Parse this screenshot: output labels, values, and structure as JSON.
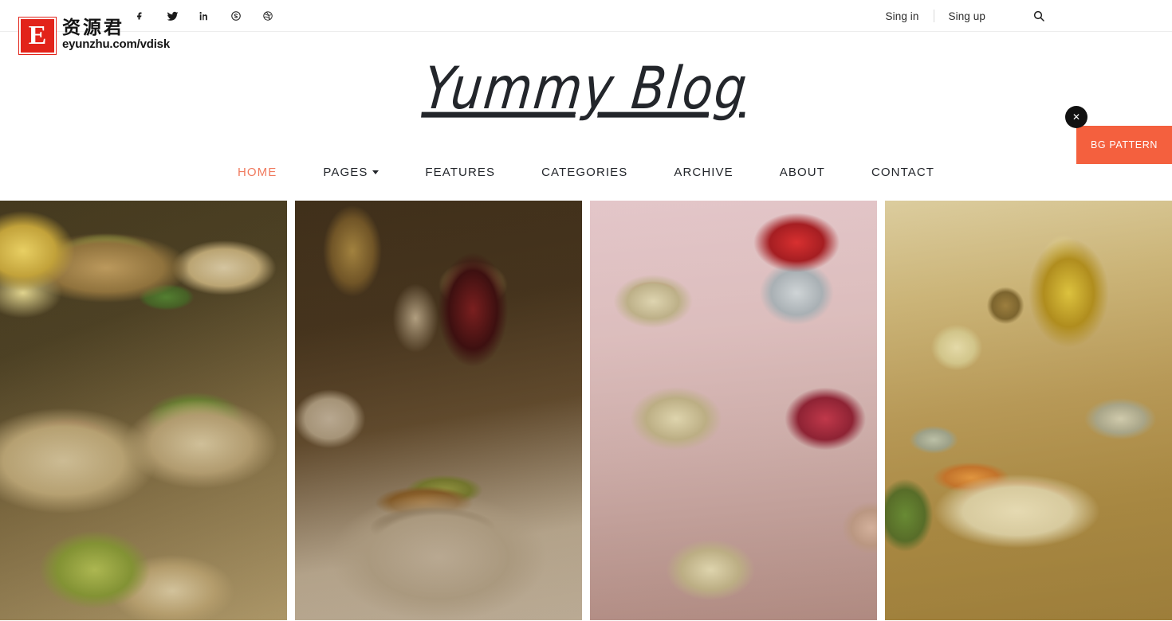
{
  "topbar": {
    "social": [
      {
        "name": "facebook-icon",
        "label": "Facebook"
      },
      {
        "name": "twitter-icon",
        "label": "Twitter"
      },
      {
        "name": "linkedin-icon",
        "label": "LinkedIn"
      },
      {
        "name": "skype-icon",
        "label": "Skype"
      },
      {
        "name": "dribbble-icon",
        "label": "Dribbble"
      }
    ],
    "sign_in": "Sing in",
    "sign_up": "Sing up",
    "search_icon": "search-icon"
  },
  "watermark": {
    "mark": "E",
    "cn": "资源君",
    "url": "eyunzhu.com/vdisk"
  },
  "brand": {
    "title": "Yummy Blog"
  },
  "bg_panel": {
    "label": "BG PATTERN",
    "close_label": "✕",
    "color": "#f4603e"
  },
  "nav": {
    "accent_color": "#f07a5e",
    "items": [
      {
        "label": "HOME",
        "active": true,
        "has_dropdown": false
      },
      {
        "label": "PAGES",
        "active": false,
        "has_dropdown": true
      },
      {
        "label": "FEATURES",
        "active": false,
        "has_dropdown": false
      },
      {
        "label": "CATEGORIES",
        "active": false,
        "has_dropdown": false
      },
      {
        "label": "ARCHIVE",
        "active": false,
        "has_dropdown": false
      },
      {
        "label": "ABOUT",
        "active": false,
        "has_dropdown": false
      },
      {
        "label": "CONTACT",
        "active": false,
        "has_dropdown": false
      }
    ]
  },
  "gallery": {
    "items": [
      {
        "alt": "Steak tacos with lime and salsa verde on dark wood"
      },
      {
        "alt": "Seared salmon with cucumber salsa and red wine glass"
      },
      {
        "alt": "Strawberry muesli parfaits in glass cups with berries"
      },
      {
        "alt": "Tomato bruschetta on wooden board with olive oil"
      }
    ]
  }
}
